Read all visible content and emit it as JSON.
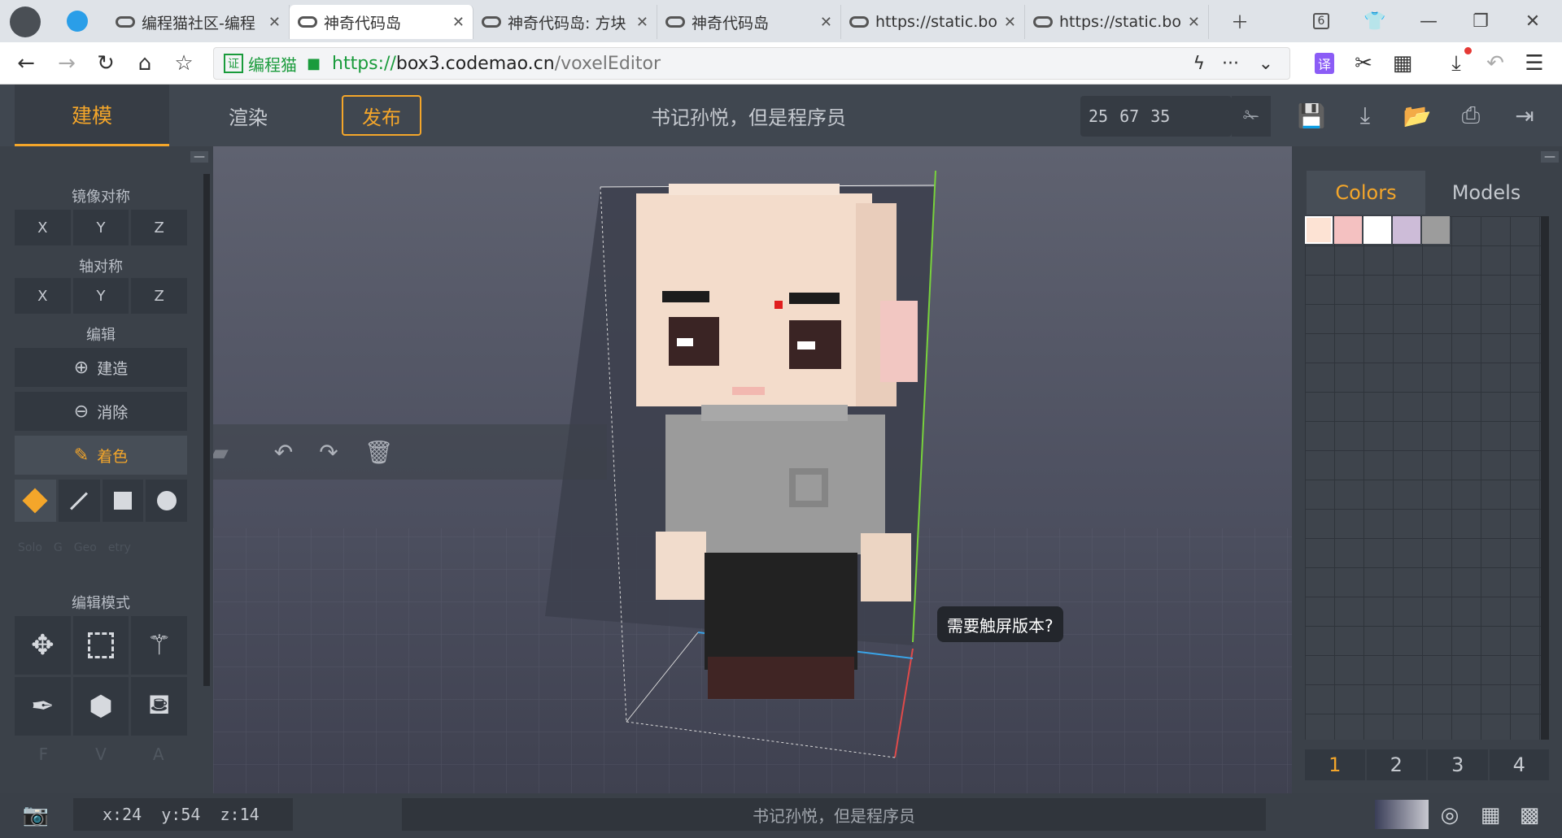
{
  "browser": {
    "tabs": [
      {
        "label": "编程猫社区-编程"
      },
      {
        "label": "神奇代码岛"
      },
      {
        "label": "神奇代码岛: 方块"
      },
      {
        "label": "神奇代码岛"
      },
      {
        "label": "https://static.bo"
      },
      {
        "label": "https://static.bo"
      }
    ],
    "tab_count": "6",
    "cert_label": "编程猫",
    "url_scheme": "https://",
    "url_host": "box3.codemao.cn",
    "url_path": "/voxelEditor",
    "ext_label": "译"
  },
  "app": {
    "tabs": {
      "model": "建模",
      "render": "渲染",
      "publish": "发布"
    },
    "project_title": "书记孙悦，但是程序员",
    "coords": {
      "x": "25",
      "y": "67",
      "z": "35"
    },
    "left": {
      "mirror_title": "镜像对称",
      "mirror": [
        "X",
        "Y",
        "Z"
      ],
      "axis_title": "轴对称",
      "axis": [
        "X",
        "Y",
        "Z"
      ],
      "edit_title": "编辑",
      "build": "建造",
      "erase": "消除",
      "paint": "着色",
      "mode_title": "编辑模式",
      "fva": [
        "F",
        "V",
        "A"
      ],
      "ghost_text": [
        "Solo",
        "G",
        "Geo",
        "etry"
      ]
    },
    "right": {
      "tabs": [
        "Colors",
        "Models"
      ],
      "palette": [
        "#fde3d4",
        "#f4c1c1",
        "#ffffff",
        "#cdbcd8",
        "#9c9c9c"
      ],
      "pages": [
        "1",
        "2",
        "3",
        "4"
      ]
    },
    "touch_prompt": "需要触屏版本?",
    "status": {
      "coords": "x:24  y:54  z:14",
      "project": "书记孙悦，但是程序员"
    }
  }
}
